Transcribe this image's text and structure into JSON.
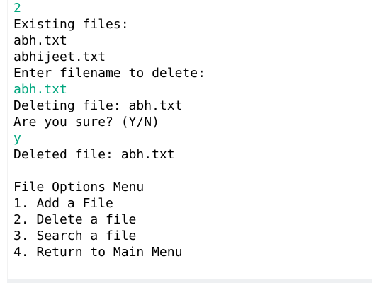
{
  "console": {
    "lines": [
      {
        "text": "2",
        "kind": "input"
      },
      {
        "text": "Existing files:",
        "kind": "output"
      },
      {
        "text": "abh.txt",
        "kind": "output"
      },
      {
        "text": "abhijeet.txt",
        "kind": "output"
      },
      {
        "text": "Enter filename to delete:",
        "kind": "output"
      },
      {
        "text": "abh.txt",
        "kind": "input"
      },
      {
        "text": "Deleting file: abh.txt",
        "kind": "output"
      },
      {
        "text": "Are you sure? (Y/N)",
        "kind": "output"
      },
      {
        "text": "y",
        "kind": "input"
      },
      {
        "text": "Deleted file: abh.txt",
        "kind": "output"
      },
      {
        "text": "",
        "kind": "output"
      },
      {
        "text": "File Options Menu",
        "kind": "output"
      },
      {
        "text": "1. Add a File",
        "kind": "output"
      },
      {
        "text": "2. Delete a file",
        "kind": "output"
      },
      {
        "text": "3. Search a file",
        "kind": "output"
      },
      {
        "text": "4. Return to Main Menu",
        "kind": "output"
      }
    ]
  },
  "colors": {
    "input_text": "#00a67e",
    "output_text": "#000000",
    "background": "#ffffff"
  }
}
